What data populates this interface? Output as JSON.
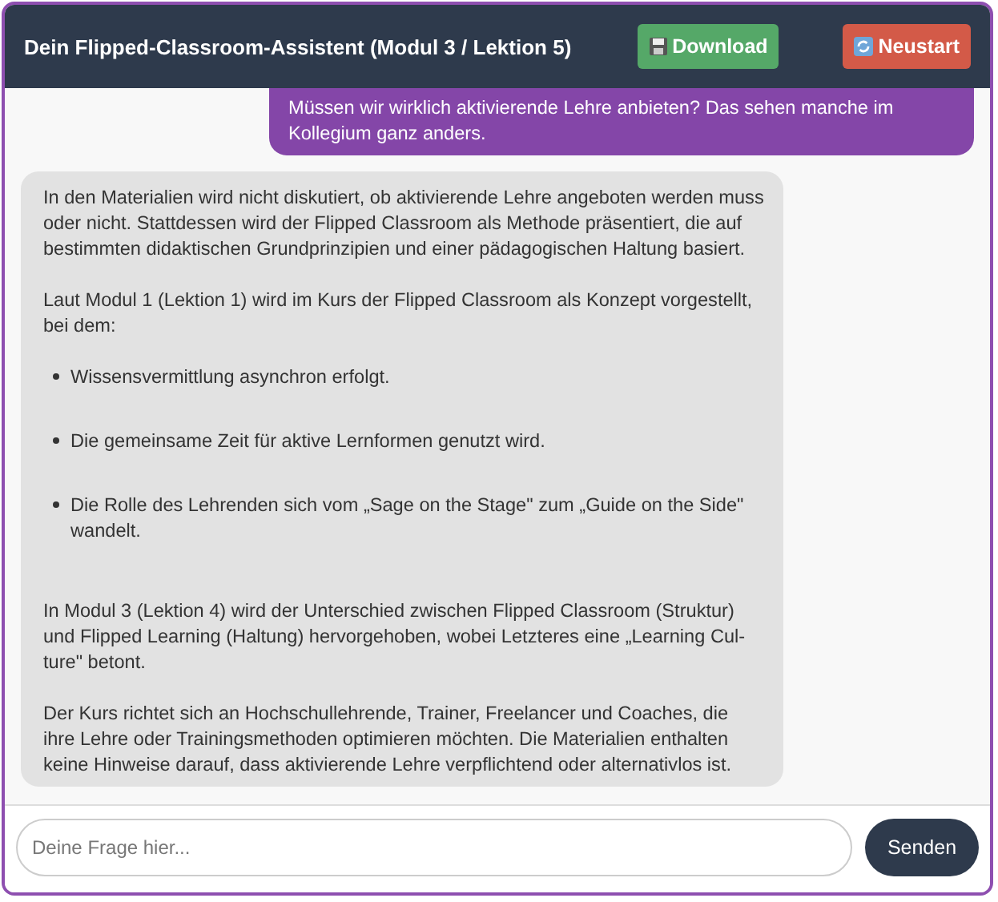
{
  "header": {
    "title": "Dein Flipped-Classroom-Assistent (Modul 3 / Lektion 5)",
    "buttons": [
      {
        "kind": "download",
        "label": "Download"
      },
      {
        "kind": "restart",
        "label": "Neustart"
      }
    ]
  },
  "messages": [
    {
      "kind": "user",
      "blocks": [
        {
          "kind": "paragraph",
          "text": "Müssen wir wirklich aktivierende Lehre anbieten? Das sehen manche im Kollegium ganz anders."
        }
      ]
    },
    {
      "kind": "assistant",
      "blocks": [
        {
          "kind": "paragraph",
          "text": "In den Materialien wird nicht diskutiert, ob aktivierende Lehre angeboten werden muss oder nicht. Stattdessen wird der Flipped Classroom als Methode präsentiert, die auf bestimmten didaktischen Grundprinzipien und einer pädagogischen Haltung basiert."
        },
        {
          "kind": "paragraph",
          "text": "Laut Modul 1 (Lektion 1) wird im Kurs der Flipped Classroom als Konzept vorgestellt, bei dem:"
        },
        {
          "kind": "list",
          "items": [
            "Wissensvermittlung asynchron erfolgt.",
            "Die gemeinsame Zeit für aktive Lernformen genutzt wird.",
            "Die Rolle des Lehrenden sich vom „Sage on the Stage\" zum „Guide on the Side\" wandelt."
          ]
        },
        {
          "kind": "paragraph",
          "text": "In Modul 3 (Lektion 4) wird der Unterschied zwischen Flipped Classroom (Struktur) und Flipped Learning (Haltung) hervorgehoben, wobei Letzteres eine „Learning Cul-ture\" betont."
        },
        {
          "kind": "paragraph",
          "text": "Der Kurs richtet sich an Hochschullehrende, Trainer, Freelancer und Coaches, die ihre Lehre oder Trainingsmethoden optimieren möchten. Die Materialien enthalten keine Hinweise darauf, dass aktivierende Lehre verpflichtend oder alternativlos ist."
        }
      ]
    }
  ],
  "input": {
    "placeholder": "Deine Frage hier..."
  },
  "send_button": {
    "label": "Senden"
  }
}
